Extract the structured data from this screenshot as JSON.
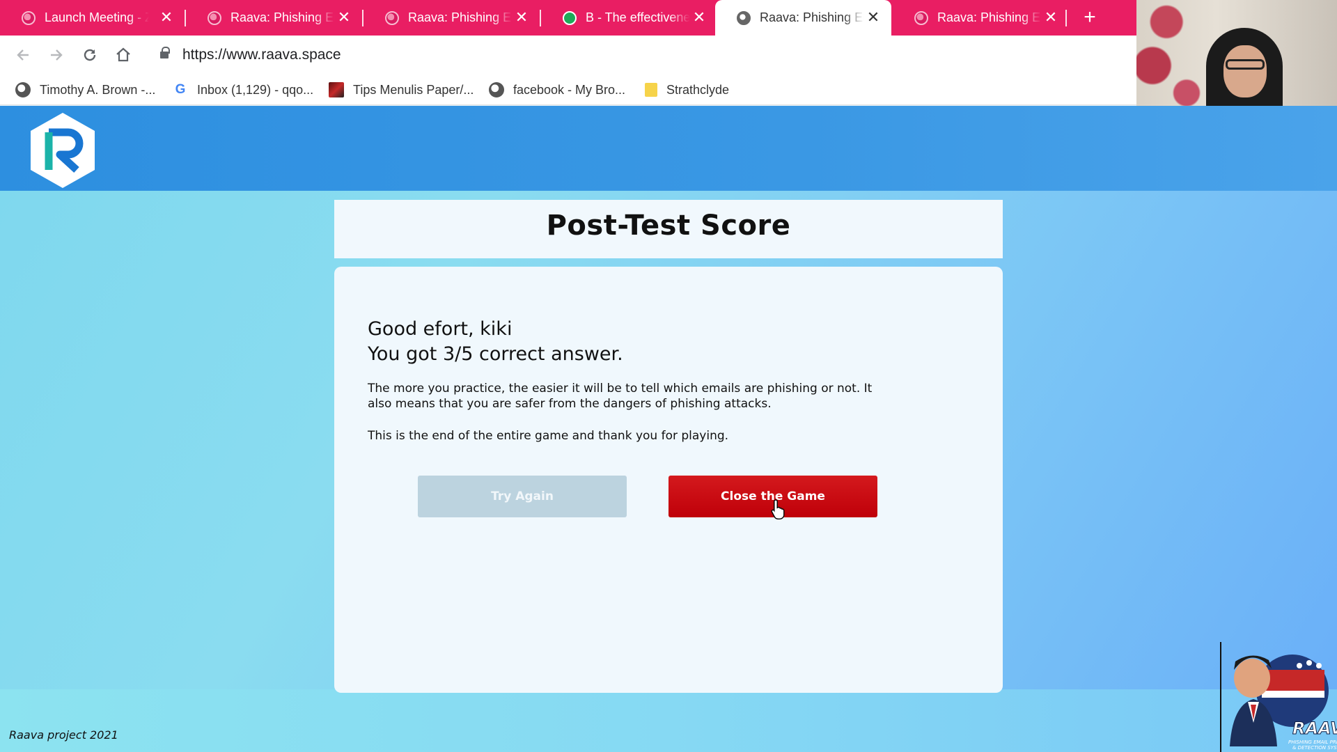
{
  "browser": {
    "tabs": [
      {
        "title": "Launch Meeting - Z",
        "icon": "globe-icon",
        "active": false
      },
      {
        "title": "Raava: Phishing Em",
        "icon": "globe-icon",
        "active": false
      },
      {
        "title": "Raava: Phishing Em",
        "icon": "globe-icon",
        "active": false
      },
      {
        "title": "B - The effectivenes",
        "icon": "cloud-icon",
        "active": false
      },
      {
        "title": "Raava: Phishing Em",
        "icon": "globe-icon",
        "active": true
      },
      {
        "title": "Raava: Phishing Em",
        "icon": "globe-icon",
        "active": false
      }
    ],
    "close_glyph": "✕",
    "new_tab_glyph": "+",
    "url": "https://www.raava.space",
    "bookmarks": [
      {
        "label": "Timothy A. Brown -...",
        "icon": "globe-icon"
      },
      {
        "label": "Inbox (1,129) - qqo...",
        "icon": "google-icon"
      },
      {
        "label": "Tips Menulis Paper/...",
        "icon": "thumbnail-icon"
      },
      {
        "label": "facebook - My Bro...",
        "icon": "globe-icon"
      },
      {
        "label": "Strathclyde",
        "icon": "folder-icon"
      }
    ]
  },
  "page": {
    "title": "Post-Test Score",
    "greeting_line1": "Good efort, kiki",
    "greeting_line2": "You got 3/5 correct answer.",
    "paragraph1": "The more you practice, the easier it will be to tell which emails are phishing or not. It also means that you are safer from the dangers of phishing attacks.",
    "paragraph2": "This is the end of the entire game and thank you for playing.",
    "try_again_label": "Try Again",
    "close_game_label": "Close the Game",
    "footer": "Raava project 2021"
  },
  "colors": {
    "tab_strip": "#e91e63",
    "header": "#2d8fe0",
    "close_button": "#c8000b",
    "try_again_disabled": "#bcd3df"
  }
}
